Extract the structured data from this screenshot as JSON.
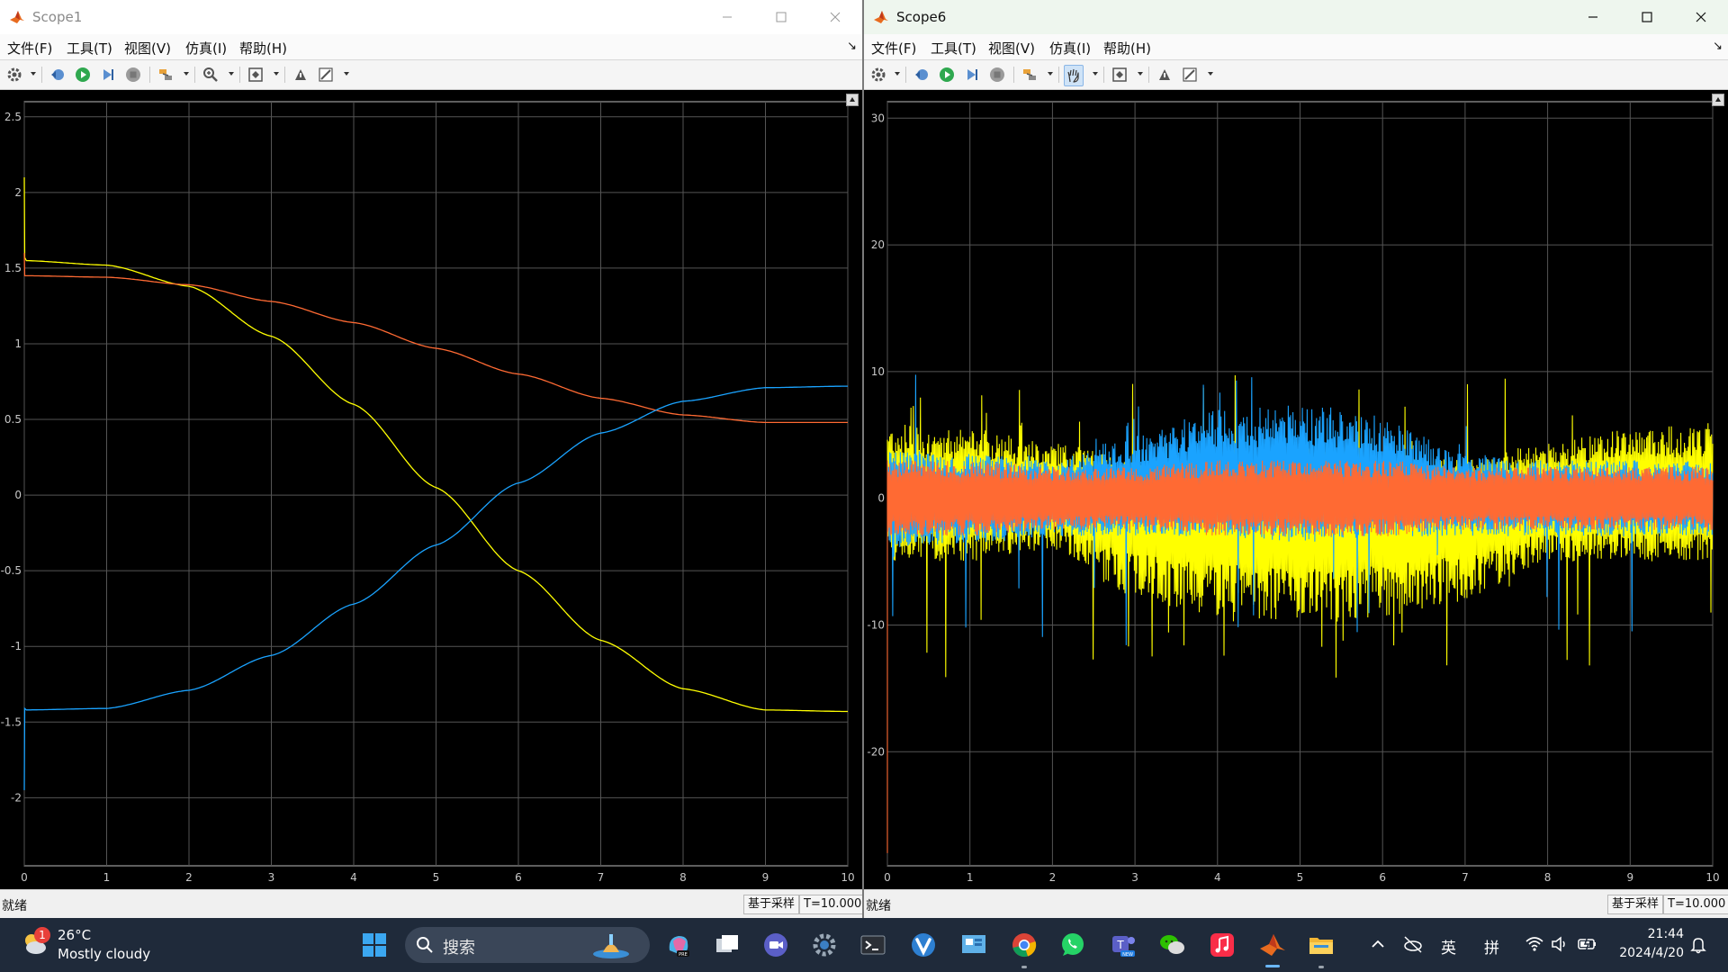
{
  "windows": [
    {
      "title": "Scope1",
      "menu": [
        "文件(F)",
        "工具(T)",
        "视图(V)",
        "仿真(I)",
        "帮助(H)"
      ],
      "status": {
        "state": "就绪",
        "mode": "基于采样",
        "time": "T=10.000"
      }
    },
    {
      "title": "Scope6",
      "menu": [
        "文件(F)",
        "工具(T)",
        "视图(V)",
        "仿真(I)",
        "帮助(H)"
      ],
      "status": {
        "state": "就绪",
        "mode": "基于采样",
        "time": "T=10.000"
      }
    }
  ],
  "toolbar_icons": [
    "settings-gear-icon",
    "restore-step-back-icon",
    "run-icon",
    "step-forward-icon",
    "stop-icon",
    "highlight-signal-icon",
    "zoom-icon",
    "autoscale-icon",
    "write-signal-icon",
    "style-icon"
  ],
  "colors": {
    "trace_yellow": "#ffff00",
    "trace_blue": "#1aa3ff",
    "trace_orange": "#ff6a33",
    "grid": "#555555",
    "axes_bg": "#000000"
  },
  "chart_data": [
    {
      "type": "line",
      "title": "",
      "xlabel": "",
      "ylabel": "",
      "xlim": [
        0,
        10
      ],
      "ylim": [
        -2.45,
        2.6
      ],
      "xticks": [
        "0",
        "1",
        "2",
        "3",
        "4",
        "5",
        "6",
        "7",
        "8",
        "9",
        "10"
      ],
      "yticks": [
        "2.5",
        "2",
        "1.5",
        "1",
        "0.5",
        "0",
        "-0.5",
        "-1",
        "-1.5",
        "-2"
      ],
      "grid": true,
      "legend": "none",
      "x": [
        0,
        1,
        2,
        3,
        4,
        5,
        6,
        7,
        8,
        9,
        10
      ],
      "series": [
        {
          "color": "#ffff00",
          "initial": [
            2.1,
            1.57
          ],
          "values": [
            1.55,
            1.52,
            1.38,
            1.05,
            0.6,
            0.05,
            -0.5,
            -0.96,
            -1.28,
            -1.42,
            -1.43
          ]
        },
        {
          "color": "#ff6a33",
          "initial": [
            1.6,
            1.45
          ],
          "values": [
            1.45,
            1.44,
            1.39,
            1.28,
            1.14,
            0.97,
            0.8,
            0.64,
            0.53,
            0.48,
            0.48
          ]
        },
        {
          "color": "#1aa3ff",
          "initial": [
            -1.95,
            -1.41
          ],
          "values": [
            -1.42,
            -1.41,
            -1.29,
            -1.06,
            -0.72,
            -0.33,
            0.08,
            0.41,
            0.62,
            0.71,
            0.72
          ]
        }
      ]
    },
    {
      "type": "line",
      "title": "",
      "xlabel": "",
      "ylabel": "",
      "xlim": [
        0,
        10
      ],
      "ylim": [
        -29,
        31.3
      ],
      "xticks": [
        "0",
        "1",
        "2",
        "3",
        "4",
        "5",
        "6",
        "7",
        "8",
        "9",
        "10"
      ],
      "yticks": [
        "30",
        "20",
        "10",
        "0",
        "-10",
        "-20"
      ],
      "grid": true,
      "legend": "none",
      "x": [
        0,
        1,
        2,
        3,
        4,
        5,
        6,
        7,
        8,
        9,
        10
      ],
      "series": [
        {
          "color": "#ffff00",
          "envelope_upper": [
            6,
            5.5,
            4.5,
            3,
            3.5,
            4,
            3.5,
            3,
            4.5,
            5.5,
            6
          ],
          "envelope_lower": [
            -5,
            -5,
            -4,
            -8,
            -9.5,
            -10,
            -9.5,
            -8,
            -5,
            -5,
            -5
          ],
          "spike_max": 9.8,
          "spike_min": -14.5
        },
        {
          "color": "#1aa3ff",
          "envelope_upper": [
            4,
            3.5,
            3,
            5,
            7,
            7.5,
            6.5,
            3.5,
            3,
            3,
            3
          ],
          "envelope_lower": [
            -4,
            -3.5,
            -3,
            -3,
            -3,
            -3.5,
            -3,
            -3,
            -3,
            -3,
            -3
          ],
          "spike_max": 10.5,
          "spike_min": -12
        },
        {
          "color": "#ff6a33",
          "envelope_upper": [
            3,
            3,
            2.5,
            2.5,
            3,
            3,
            3,
            2.5,
            2.5,
            2.5,
            2.5
          ],
          "envelope_lower": [
            -3,
            -3,
            -2.5,
            -2.5,
            -3,
            -3,
            -3,
            -2.5,
            -2.5,
            -2.5,
            -2.5
          ],
          "initial": [
            -28,
            3
          ]
        }
      ]
    }
  ],
  "taskbar": {
    "weather": {
      "badge": "1",
      "temp": "26°C",
      "desc": "Mostly cloudy"
    },
    "search_placeholder": "搜索",
    "tray": {
      "ime1": "英",
      "ime2": "拼"
    },
    "time": "21:44",
    "date": "2024/4/20"
  }
}
